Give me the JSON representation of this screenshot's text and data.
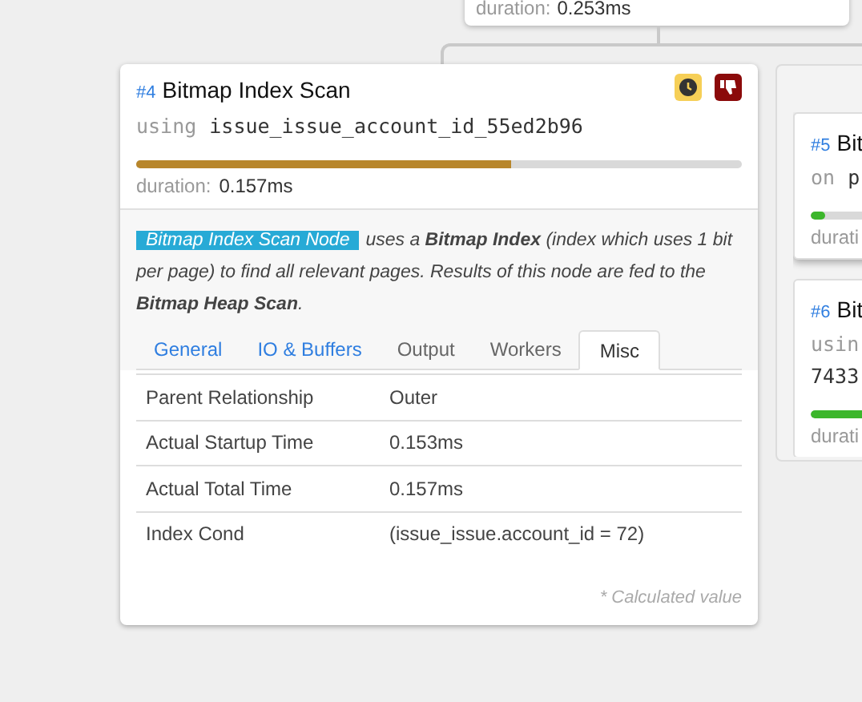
{
  "top_node": {
    "duration_label": "duration:",
    "duration": "0.253ms"
  },
  "node": {
    "number": "#4",
    "title": "Bitmap Index Scan",
    "keyword": "using",
    "index_name": "issue_issue_account_id_55ed2b96",
    "level": 0.62,
    "duration_label": "duration:",
    "duration": "0.157ms",
    "badges": [
      {
        "kind": "clock"
      },
      {
        "kind": "thumbs-down"
      }
    ],
    "node_tag": "Bitmap Index Scan Node",
    "description": "uses a **Bitmap Index** (index which uses 1 bit per page) to find all relevant pages. Results of this node are fed to the **Bitmap Heap Scan**.",
    "tabs": [
      {
        "label": "General",
        "has_data": true,
        "selected": false
      },
      {
        "label": "IO & Buffers",
        "has_data": true,
        "selected": false
      },
      {
        "label": "Output",
        "has_data": false,
        "selected": false
      },
      {
        "label": "Workers",
        "has_data": false,
        "selected": false
      },
      {
        "label": "Misc",
        "has_data": false,
        "selected": true
      }
    ],
    "rows": [
      {
        "label": "Parent Relationship",
        "value": "Outer"
      },
      {
        "label": "Actual Startup Time",
        "value": "0.153ms"
      },
      {
        "label": "Actual Total Time",
        "value": "0.157ms"
      },
      {
        "label": "Index Cond",
        "value": "(issue_issue.account_id = 72)"
      }
    ],
    "footnote": "* Calculated value"
  },
  "side_nodes": [
    {
      "number": "#5",
      "title": "Bit",
      "lines": [
        {
          "keyword": "on",
          "text": "p"
        }
      ],
      "level": 0.04,
      "duration_label": "durati",
      "raised": true
    },
    {
      "number": "#6",
      "title": "Bit",
      "lines": [
        {
          "keyword": "usin"
        },
        {
          "text": "7433"
        }
      ],
      "level": 0.7,
      "duration_label": "durati",
      "raised": false
    }
  ]
}
